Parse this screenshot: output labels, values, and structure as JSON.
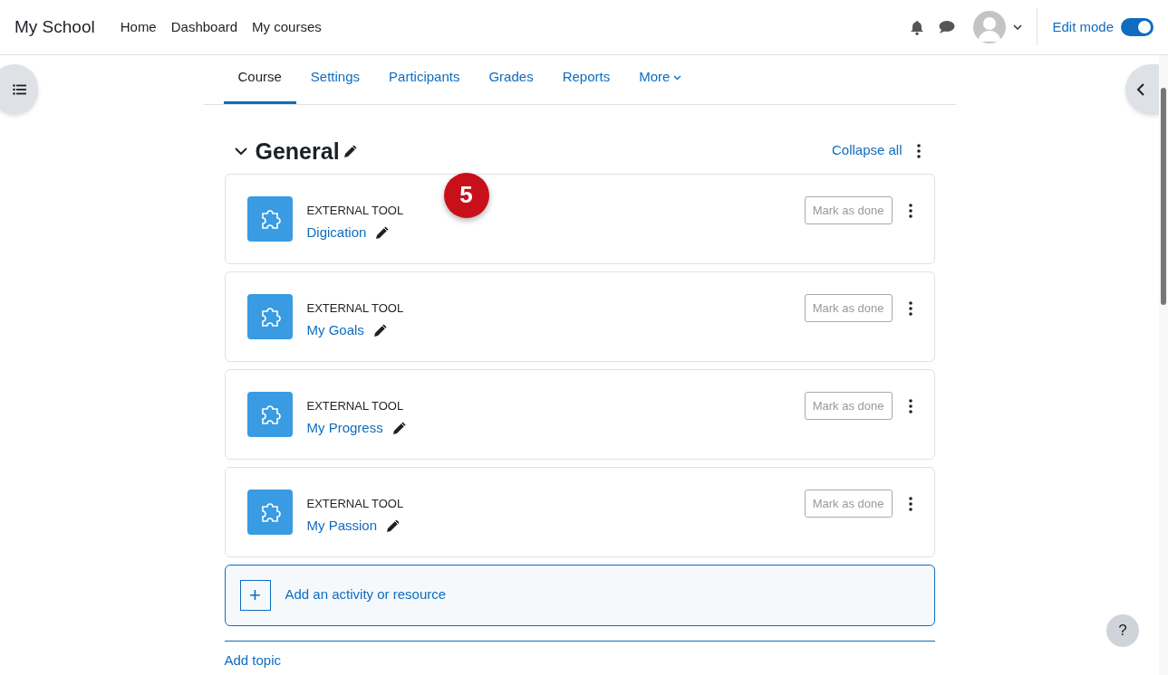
{
  "navbar": {
    "site_name": "My School",
    "links": [
      {
        "label": "Home"
      },
      {
        "label": "Dashboard"
      },
      {
        "label": "My courses"
      }
    ],
    "edit_mode": {
      "label": "Edit mode",
      "on": true
    }
  },
  "course_tabs": [
    {
      "label": "Course",
      "selected": true
    },
    {
      "label": "Settings",
      "selected": false
    },
    {
      "label": "Participants",
      "selected": false
    },
    {
      "label": "Grades",
      "selected": false
    },
    {
      "label": "Reports",
      "selected": false
    },
    {
      "label": "More",
      "selected": false,
      "kind": "dropdown"
    }
  ],
  "section": {
    "title": "General",
    "expanded": true,
    "collapse_link": "Collapse all"
  },
  "step_badge": "5",
  "activities": [
    {
      "type_label": "EXTERNAL TOOL",
      "name": "Digication",
      "completion_button": "Mark as done"
    },
    {
      "type_label": "EXTERNAL TOOL",
      "name": "My Goals",
      "completion_button": "Mark as done"
    },
    {
      "type_label": "EXTERNAL TOOL",
      "name": "My Progress",
      "completion_button": "Mark as done"
    },
    {
      "type_label": "EXTERNAL TOOL",
      "name": "My Passion",
      "completion_button": "Mark as done"
    }
  ],
  "add_activity": {
    "icon": "+",
    "label": "Add an activity or resource"
  },
  "add_topic": "Add topic",
  "help_button": "?"
}
